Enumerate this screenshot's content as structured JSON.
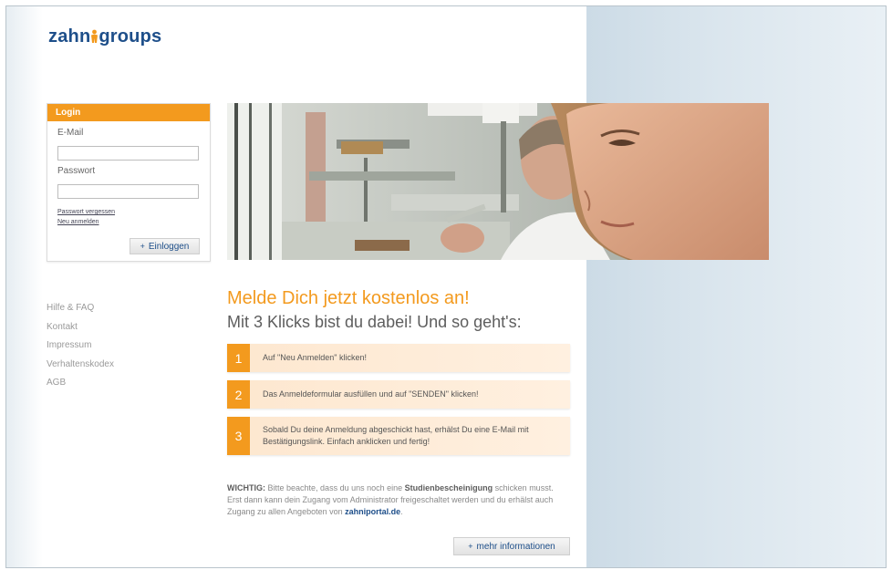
{
  "logo": {
    "part1": "zahn",
    "part2": "groups"
  },
  "login": {
    "title": "Login",
    "email_label": "E-Mail",
    "email_value": "",
    "password_label": "Passwort",
    "password_value": "",
    "forgot_link": "Passwort vergessen",
    "register_link": "Neu anmelden",
    "submit_label": "Einloggen"
  },
  "nav": [
    "Hilfe & FAQ",
    "Kontakt",
    "Impressum",
    "Verhaltenskodex",
    "AGB"
  ],
  "headline": "Melde Dich jetzt kostenlos an!",
  "subline": "Mit 3 Klicks bist du dabei! Und so geht's:",
  "steps": [
    {
      "num": "1",
      "text": "Auf \"Neu Anmelden\" klicken!"
    },
    {
      "num": "2",
      "text": "Das Anmeldeformular ausfüllen und auf \"SENDEN\" klicken!"
    },
    {
      "num": "3",
      "text": "Sobald Du deine Anmeldung abgeschickt hast, erhälst Du eine E-Mail mit Bestätigungslink. Einfach anklicken und fertig!"
    }
  ],
  "notice": {
    "label": "WICHTIG:",
    "text1": "Bitte beachte, dass du uns noch eine",
    "bold": "Studienbescheinigung",
    "text2": "schicken musst. Erst dann kann dein Zugang vom Administrator freigeschaltet werden und du erhälst auch Zugang zu allen Angeboten von",
    "portal": "zahniportal.de",
    "end": "."
  },
  "more_button": "mehr informationen",
  "colors": {
    "accent": "#f39a1e",
    "brand": "#1e4f8a"
  }
}
